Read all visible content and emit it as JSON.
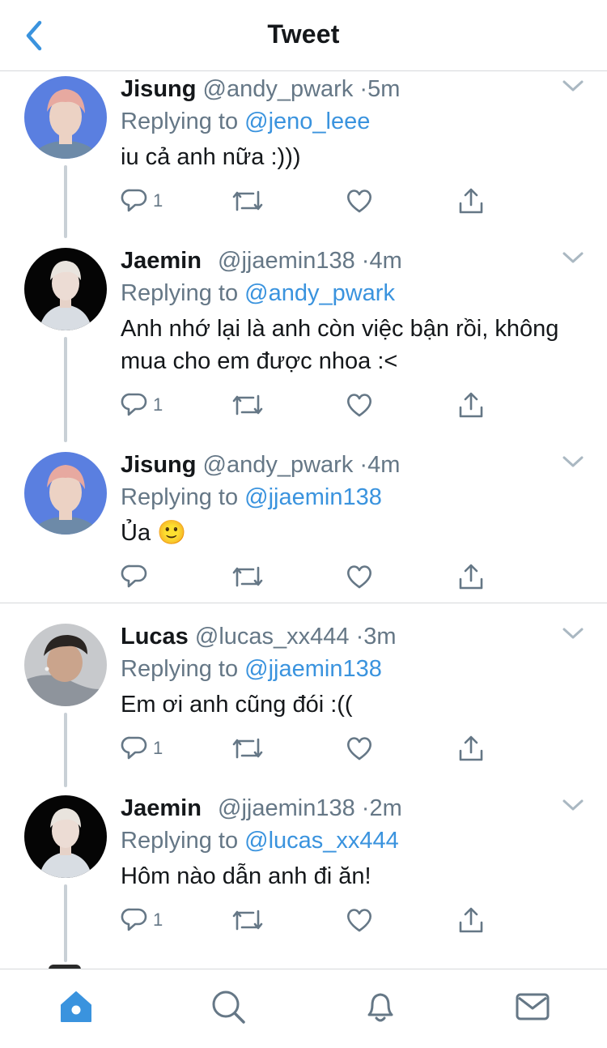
{
  "header": {
    "title": "Tweet"
  },
  "tweets": [
    {
      "name": "Jisung",
      "handle": "@andy_pwark",
      "dot": "·",
      "time": "5m",
      "replying_prefix": "Replying to",
      "replying_to": "@jeno_leee",
      "body": "iu cả anh nữa :)))",
      "reply_count": "1",
      "avatar_icon": "jisung-avatar"
    },
    {
      "name": "Jaemin",
      "handle": "@jjaemin138",
      "dot": "·",
      "time": "4m",
      "replying_prefix": "Replying to",
      "replying_to": "@andy_pwark",
      "body": "Anh nhớ lại là anh còn việc bận rồi, không mua cho em được nhoa :<",
      "reply_count": "1",
      "avatar_icon": "jaemin-avatar"
    },
    {
      "name": "Jisung",
      "handle": "@andy_pwark",
      "dot": "·",
      "time": "4m",
      "replying_prefix": "Replying to",
      "replying_to": "@jjaemin138",
      "body": "Ủa 🙂",
      "reply_count": "",
      "avatar_icon": "jisung-avatar"
    },
    {
      "name": "Lucas",
      "handle": "@lucas_xx444",
      "dot": "·",
      "time": "3m",
      "replying_prefix": "Replying to",
      "replying_to": "@jjaemin138",
      "body": "Em ơi anh cũng đói :((",
      "reply_count": "1",
      "avatar_icon": "lucas-avatar"
    },
    {
      "name": "Jaemin",
      "handle": "@jjaemin138",
      "dot": "·",
      "time": "2m",
      "replying_prefix": "Replying to",
      "replying_to": "@lucas_xx444",
      "body": "Hôm nào dẫn anh đi ăn!",
      "reply_count": "1",
      "avatar_icon": "jaemin-avatar"
    }
  ],
  "tabbar": {
    "items": [
      {
        "icon": "home-icon",
        "active": true
      },
      {
        "icon": "search-icon",
        "active": false
      },
      {
        "icon": "bell-icon",
        "active": false
      },
      {
        "icon": "mail-icon",
        "active": false
      }
    ]
  },
  "colors": {
    "accent": "#3a93de",
    "secondary_text": "#657786",
    "primary_text": "#14171a",
    "divider": "#d6d9db",
    "thread_line": "#c9d0d6"
  }
}
